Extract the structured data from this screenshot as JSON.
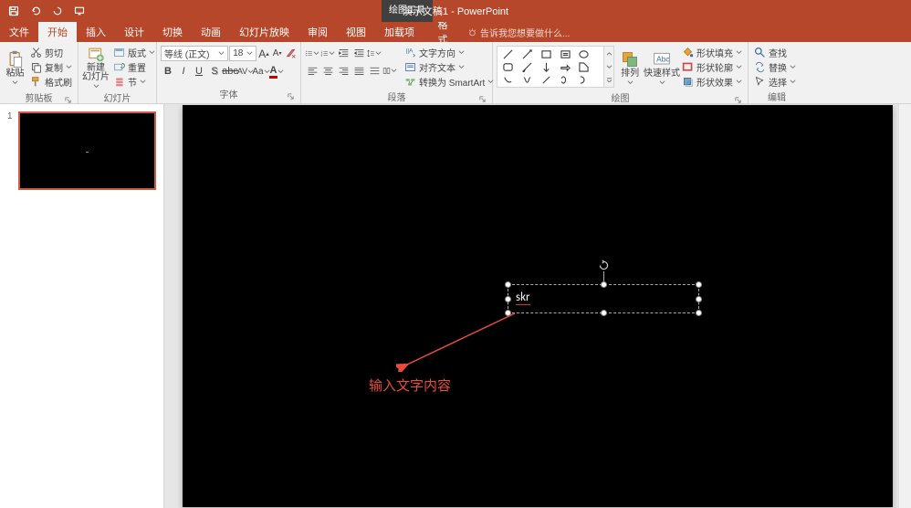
{
  "app_title": "演示文稿1 - PowerPoint",
  "context_tool": "绘图工具",
  "tabs": {
    "file": "文件",
    "home": "开始",
    "insert": "插入",
    "design": "设计",
    "transitions": "切换",
    "animations": "动画",
    "slideshow": "幻灯片放映",
    "review": "审阅",
    "view": "视图",
    "addins": "加载项",
    "format": "格式"
  },
  "tell_me": "告诉我您想要做什么...",
  "clipboard": {
    "paste": "粘贴",
    "cut": "剪切",
    "copy": "复制",
    "painter": "格式刷",
    "label": "剪贴板"
  },
  "slides": {
    "new": "新建",
    "new2": "幻灯片",
    "layout": "版式",
    "reset": "重置",
    "section": "节",
    "label": "幻灯片"
  },
  "font": {
    "name": "等线 (正文)",
    "size": "18",
    "label": "字体"
  },
  "paragraph": {
    "textdir": "文字方向",
    "align": "对齐文本",
    "smartart": "转换为 SmartArt",
    "label": "段落"
  },
  "drawing": {
    "arrange": "排列",
    "quick": "快速样式",
    "fill": "形状填充",
    "outline": "形状轮廓",
    "effects": "形状效果",
    "label": "绘图"
  },
  "editing": {
    "find": "查找",
    "replace": "替换",
    "select": "选择",
    "label": "编辑"
  },
  "slide_num": "1",
  "textbox_content": "skr",
  "annotation": "输入文字内容"
}
